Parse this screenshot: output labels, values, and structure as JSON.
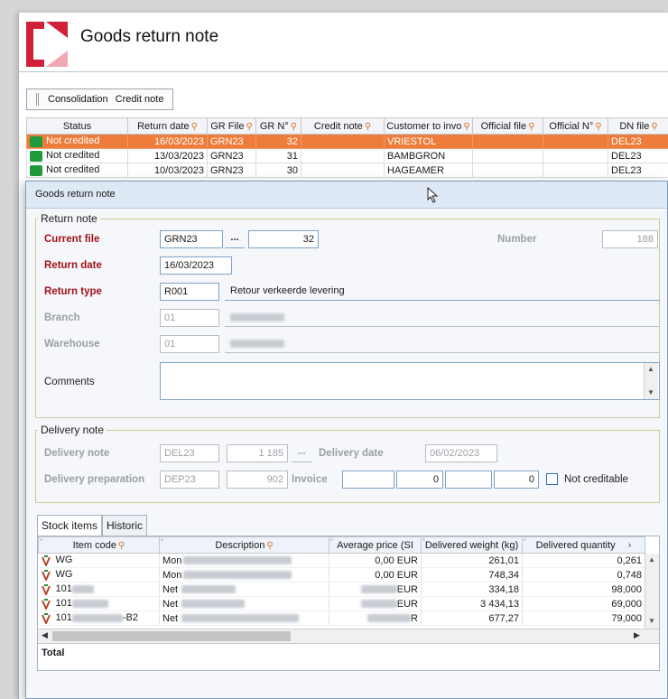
{
  "app": {
    "title": "Goods return note"
  },
  "toolbar": {
    "consolidation": "Consolidation",
    "credit_note": "Credit note"
  },
  "grid": {
    "columns": [
      "Status",
      "Return date",
      "GR File",
      "GR N°",
      "Credit note",
      "Customer to invo",
      "Official file",
      "Official N°",
      "DN file"
    ],
    "rows": [
      {
        "status": "Not credited",
        "return_date": "16/03/2023",
        "gr_file": "GRN23",
        "gr_no": "32",
        "credit_note": "",
        "customer": "VRIESTOL",
        "official_file": "",
        "official_no": "",
        "dn_file": "DEL23"
      },
      {
        "status": "Not credited",
        "return_date": "13/03/2023",
        "gr_file": "GRN23",
        "gr_no": "31",
        "credit_note": "",
        "customer": "BAMBGRON",
        "official_file": "",
        "official_no": "",
        "dn_file": "DEL23"
      },
      {
        "status": "Not credited",
        "return_date": "10/03/2023",
        "gr_file": "GRN23",
        "gr_no": "30",
        "credit_note": "",
        "customer": "HAGEAMER",
        "official_file": "",
        "official_no": "",
        "dn_file": "DEL23"
      }
    ]
  },
  "dialog": {
    "title": "Goods return note",
    "return_note": {
      "legend": "Return note",
      "current_file_label": "Current file",
      "current_file_value": "GRN23",
      "ellipsis": "...",
      "current_number_value": "32",
      "number_label": "Number",
      "number_value": "188",
      "return_date_label": "Return date",
      "return_date_value": "16/03/2023",
      "return_type_label": "Return type",
      "return_type_code": "R001",
      "return_type_desc": "Retour verkeerde levering",
      "branch_label": "Branch",
      "branch_code": "01",
      "warehouse_label": "Warehouse",
      "warehouse_code": "01",
      "comments_label": "Comments",
      "comments_value": ""
    },
    "delivery_note": {
      "legend": "Delivery note",
      "delivery_note_label": "Delivery note",
      "delivery_note_file": "DEL23",
      "delivery_note_number": "1 185",
      "ellipsis": "...",
      "delivery_date_label": "Delivery date",
      "delivery_date_value": "06/02/2023",
      "preparation_label": "Delivery preparation",
      "preparation_file": "DEP23",
      "preparation_number": "902",
      "invoice_label": "Invoice",
      "invoice_number": "0",
      "invoice_number2": "0",
      "not_creditable_label": "Not creditable"
    },
    "tabs": {
      "stock_items": "Stock items",
      "historic": "Historic"
    },
    "items": {
      "columns": [
        "Item code",
        "Description",
        "Average price (SI",
        "Delivered weight (kg)",
        "Delivered quantity"
      ],
      "rows": [
        {
          "code": "WG",
          "desc": "Mon",
          "price": "0,00 EUR",
          "weight": "261,01",
          "qty": "0,261"
        },
        {
          "code": "WG",
          "desc": "Mon",
          "price": "0,00 EUR",
          "weight": "748,34",
          "qty": "0,748"
        },
        {
          "code": "101",
          "desc": "Net",
          "price": "EUR",
          "weight": "334,18",
          "qty": "98,000"
        },
        {
          "code": "101",
          "desc": "Net",
          "price": "EUR",
          "weight": "3 434,13",
          "qty": "69,000"
        },
        {
          "code": "101",
          "code_suffix": "-B2",
          "desc": "Net",
          "price": "R",
          "weight": "677,27",
          "qty": "79,000"
        }
      ],
      "total_label": "Total"
    }
  },
  "colors": {
    "selected_row": "#ee7c3a",
    "status_ok": "#1f9a3a",
    "required_label": "#a2121a",
    "brand_red": "#d1203a"
  }
}
